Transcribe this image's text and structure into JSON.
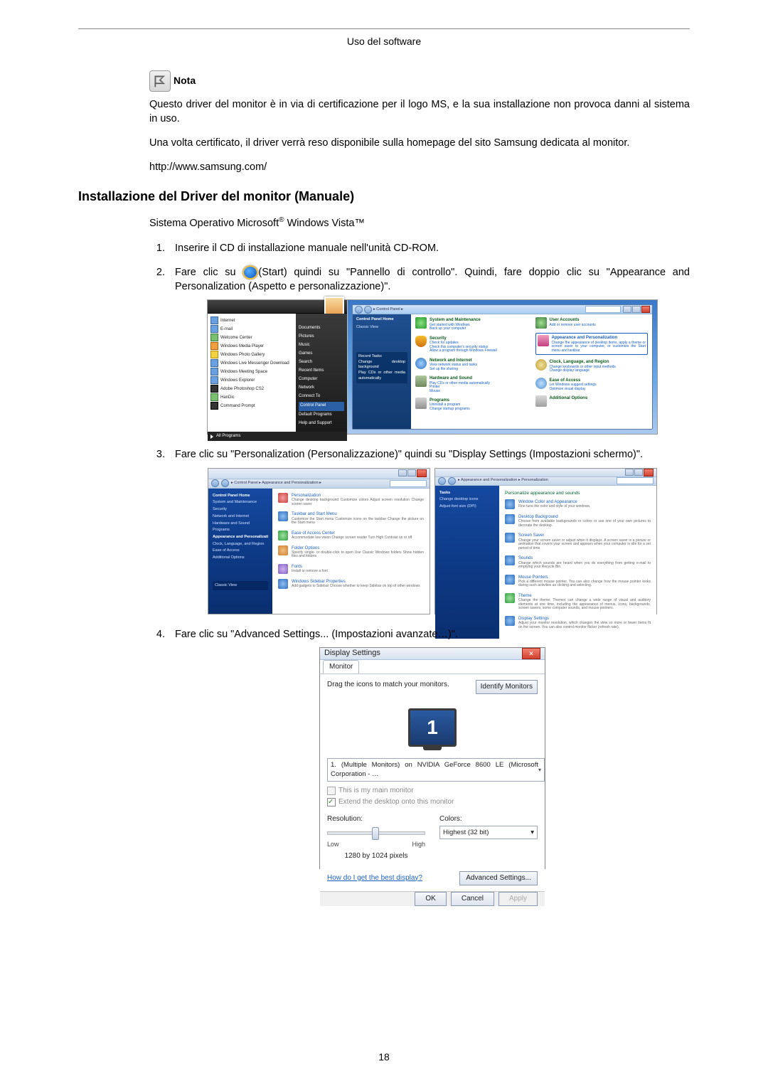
{
  "header": {
    "title": "Uso del software"
  },
  "note": {
    "label": "Nota"
  },
  "paragraphs": {
    "p1": "Questo driver del monitor è in via di certificazione per il logo MS, e la sua installazione non provoca danni al sistema in uso.",
    "p2": "Una volta certificato, il driver verrà reso disponibile sulla homepage del sito Samsung dedicata al monitor.",
    "url": "http://www.samsung.com/"
  },
  "section_title": "Installazione del Driver del monitor (Manuale)",
  "os_line_prefix": "Sistema Operativo Microsoft",
  "os_line_suffix": " Windows Vista™",
  "steps": {
    "s1": "Inserire il CD di installazione manuale nell'unità CD-ROM.",
    "s2a": "Fare clic su ",
    "s2b": "(Start) quindi su \"Pannello di controllo\". Quindi, fare doppio clic su \"Appearance and Personalization (Aspetto e personalizzazione)\".",
    "s3": "Fare clic su \"Personalization (Personalizzazione)\" quindi su \"Display Settings (Impostazioni schermo)\".",
    "s4": "Fare clic su \"Advanced Settings... (Impostazioni avanzate…)\"."
  },
  "fig1": {
    "start_menu_white": [
      "Internet",
      "E-mail",
      "Welcome Center",
      "Windows Media Player",
      "Windows Photo Gallery",
      "Windows Live Messenger Download",
      "Windows Meeting Space",
      "Windows Explorer",
      "Adobe Photoshop CS2",
      "HanDic",
      "Command Prompt"
    ],
    "start_menu_dark": [
      "",
      "Documents",
      "Pictures",
      "Music",
      "Games",
      "Search",
      "Recent Items",
      "Computer",
      "Network",
      "Connect To",
      "Control Panel",
      "Default Programs",
      "Help and Support"
    ],
    "all_programs": "All Programs",
    "cp_path": "▸ Control Panel ▸",
    "cp_side_head": "Control Panel Home",
    "cp_side_link": "Classic View",
    "cp_items_left": [
      {
        "title": "System and Maintenance",
        "sub": "Get started with Windows\nBack up your computer"
      },
      {
        "title": "Security",
        "sub": "Check for updates\nCheck this computer's security status\nAllow a program through Windows Firewall"
      },
      {
        "title": "Network and Internet",
        "sub": "View network status and tasks\nSet up file sharing"
      },
      {
        "title": "Hardware and Sound",
        "sub": "Play CDs or other media automatically\nPrinter\nMouse"
      },
      {
        "title": "Programs",
        "sub": "Uninstall a program\nChange startup programs"
      }
    ],
    "cp_items_right": [
      {
        "title": "User Accounts",
        "sub": "Add or remove user accounts"
      },
      {
        "title": "Appearance and Personalization",
        "sub": "Change the appearance of desktop items, apply a theme or screen saver to your computer, or customize the Start menu and taskbar.",
        "boxed": true
      },
      {
        "title": "Clock, Language, and Region",
        "sub": "Change keyboards or other input methods\nChange display language"
      },
      {
        "title": "Ease of Access",
        "sub": "Let Windows suggest settings\nOptimize visual display"
      },
      {
        "title": "Additional Options",
        "sub": ""
      }
    ]
  },
  "fig2": {
    "left": {
      "path": "▸ Control Panel ▸ Appearance and Personalization ▸",
      "side_head": "Control Panel Home",
      "side_items": [
        "System and Maintenance",
        "Security",
        "Network and Internet",
        "Hardware and Sound",
        "Programs",
        "Appearance and Personalization",
        "Clock, Language, and Region",
        "Ease of Access",
        "Additional Options"
      ],
      "side_current": "Appearance and Personalization",
      "side_bottom": "Classic View",
      "main_items": [
        {
          "t": "Personalization",
          "s": "Change desktop background   Customize colors   Adjust screen resolution   Change screen saver"
        },
        {
          "t": "Taskbar and Start Menu",
          "s": "Customize the Start menu   Customize icons on the taskbar   Change the picture on the Start menu"
        },
        {
          "t": "Ease of Access Center",
          "s": "Accommodate low vision   Change screen reader   Turn High Contrast on or off"
        },
        {
          "t": "Folder Options",
          "s": "Specify single- or double-click to open   Use Classic Windows folders   Show hidden files and folders"
        },
        {
          "t": "Fonts",
          "s": "Install or remove a font"
        },
        {
          "t": "Windows Sidebar Properties",
          "s": "Add gadgets to Sidebar   Choose whether to keep Sidebar on top of other windows"
        }
      ]
    },
    "right": {
      "path": "▸ Appearance and Personalization ▸ Personalization",
      "head": "Personalize appearance and sounds",
      "side_head": "Tasks",
      "side_items": [
        "Change desktop icons",
        "Adjust font size (DPI)"
      ],
      "main_items": [
        {
          "t": "Window Color and Appearance",
          "s": "Fine tune the color and style of your windows."
        },
        {
          "t": "Desktop Background",
          "s": "Choose from available backgrounds or colors or use one of your own pictures to decorate the desktop."
        },
        {
          "t": "Screen Saver",
          "s": "Change your screen saver or adjust when it displays. A screen saver is a picture or animation that covers your screen and appears when your computer is idle for a set period of time."
        },
        {
          "t": "Sounds",
          "s": "Change which sounds are heard when you do everything from getting e-mail to emptying your Recycle Bin."
        },
        {
          "t": "Mouse Pointers",
          "s": "Pick a different mouse pointer. You can also change how the mouse pointer looks during such activities as clicking and selecting."
        },
        {
          "t": "Theme",
          "s": "Change the theme. Themes can change a wide range of visual and auditory elements at one time, including the appearance of menus, icons, backgrounds, screen savers, some computer sounds, and mouse pointers."
        },
        {
          "t": "Display Settings",
          "s": "Adjust your monitor resolution, which changes the view so more or fewer items fit on the screen. You can also control monitor flicker (refresh rate)."
        }
      ]
    }
  },
  "fig3": {
    "title": "Display Settings",
    "tab": "Monitor",
    "drag_label": "Drag the icons to match your monitors.",
    "identify_btn": "Identify Monitors",
    "monitor_num": "1",
    "dropdown": "1. (Multiple Monitors) on NVIDIA GeForce 8600 LE (Microsoft Corporation - …",
    "chk1": "This is my main monitor",
    "chk2": "Extend the desktop onto this monitor",
    "resolution_label": "Resolution:",
    "low": "Low",
    "high": "High",
    "res_value": "1280 by 1024 pixels",
    "colors_label": "Colors:",
    "colors_value": "Highest (32 bit)",
    "help_link": "How do I get the best display?",
    "adv_btn": "Advanced Settings...",
    "ok": "OK",
    "cancel": "Cancel",
    "apply": "Apply"
  },
  "page_number": "18"
}
